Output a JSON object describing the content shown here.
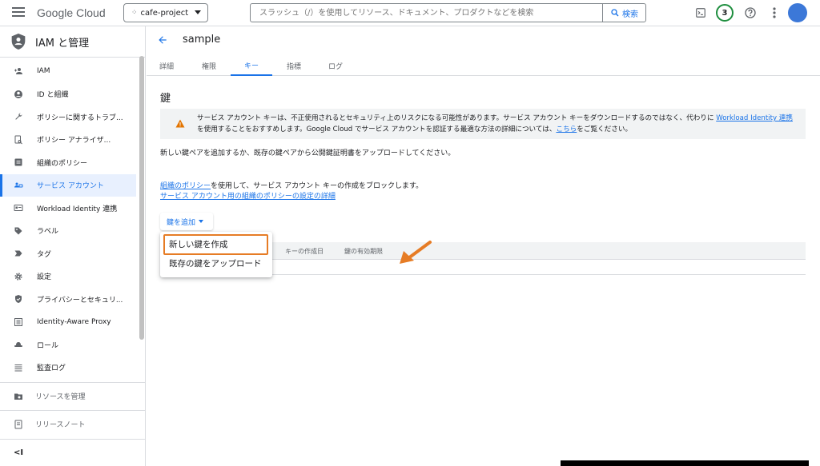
{
  "topbar": {
    "logo": {
      "google": "Google",
      "cloud": " Cloud"
    },
    "project": "cafe-project",
    "search_placeholder": "スラッシュ（/）を使用してリソース、ドキュメント、プロダクトなどを検索",
    "search_button": "検索",
    "notification_count": "3"
  },
  "sidebar": {
    "title": "IAM と管理",
    "items": [
      {
        "label": "IAM",
        "icon": "person-add-icon"
      },
      {
        "label": "ID と組織",
        "icon": "account-circle-icon"
      },
      {
        "label": "ポリシーに関するトラブ...",
        "icon": "wrench-icon"
      },
      {
        "label": "ポリシー アナライザ...",
        "icon": "document-search-icon"
      },
      {
        "label": "組織のポリシー",
        "icon": "list-box-icon"
      },
      {
        "label": "サービス アカウント",
        "icon": "service-account-icon",
        "active": true
      },
      {
        "label": "Workload Identity 連携",
        "icon": "id-card-icon"
      },
      {
        "label": "ラベル",
        "icon": "label-icon"
      },
      {
        "label": "タグ",
        "icon": "tag-icon"
      },
      {
        "label": "設定",
        "icon": "gear-icon"
      },
      {
        "label": "プライバシーとセキュリ...",
        "icon": "shield-icon"
      },
      {
        "label": "Identity-Aware Proxy",
        "icon": "proxy-icon"
      },
      {
        "label": "ロール",
        "icon": "hat-icon"
      },
      {
        "label": "監査ログ",
        "icon": "log-icon"
      }
    ],
    "manage_resources": "リソースを管理",
    "release_notes": "リリースノート",
    "collapse": "<I"
  },
  "main": {
    "title": "sample",
    "tabs": [
      "詳細",
      "権限",
      "キー",
      "指標",
      "ログ"
    ],
    "active_tab": "キー",
    "section_title": "鍵",
    "warning": {
      "part1": "サービス アカウント キーは、不正使用されるとセキュリティ上のリスクになる可能性があります。サービス アカウント キーをダウンロードするのではなく、代わりに ",
      "link1": "Workload Identity 連携",
      "part2": "を使用することをおすすめします。Google Cloud でサービス アカウントを認証する最適な方法の詳細については、",
      "link2": "こちら",
      "part3": "をご覧ください。"
    },
    "description": "新しい鍵ペアを追加するか、既存の鍵ペアから公開鍵証明書をアップロードしてください。",
    "policy": {
      "link1": "組織のポリシー",
      "text": "を使用して、サービス アカウント キーの作成をブロックします。",
      "link2": "サービス アカウント用の組織のポリシーの設定の詳細"
    },
    "add_key_button": "鍵を追加",
    "table_headers": [
      "キーの作成日",
      "鍵の有効期限"
    ],
    "dropdown": [
      "新しい鍵を作成",
      "既存の鍵をアップロード"
    ]
  },
  "colors": {
    "accent": "#1a73e8",
    "highlight": "#e67c25",
    "warning": "#e37400"
  }
}
